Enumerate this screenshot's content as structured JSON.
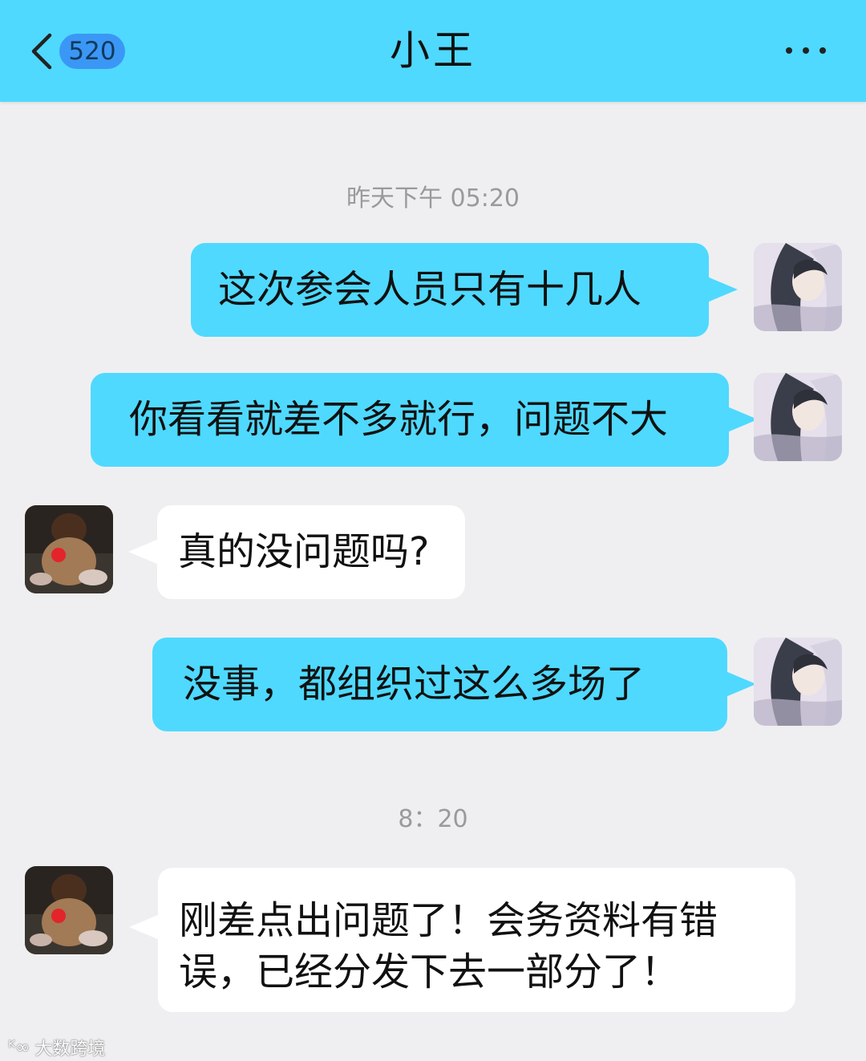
{
  "header": {
    "back_badge": "520",
    "title": "小王",
    "accent": "#4fd9ff",
    "badge_color": "#3b97f5"
  },
  "timestamps": [
    "昨天下午 05:20",
    "8：20"
  ],
  "messages": [
    {
      "from": "me",
      "text": "这次参会人员只有十几人"
    },
    {
      "from": "me",
      "text": "你看看就差不多就行，问题不大"
    },
    {
      "from": "other",
      "text": "真的没问题吗?"
    },
    {
      "from": "me",
      "text": "没事，都组织过这么多场了"
    },
    {
      "from": "other",
      "text": "刚差点出问题了！会务资料有错误，已经分发下去一部分了！"
    }
  ],
  "watermark": {
    "logo": "ᴷ∞",
    "text": "大数跨境"
  }
}
